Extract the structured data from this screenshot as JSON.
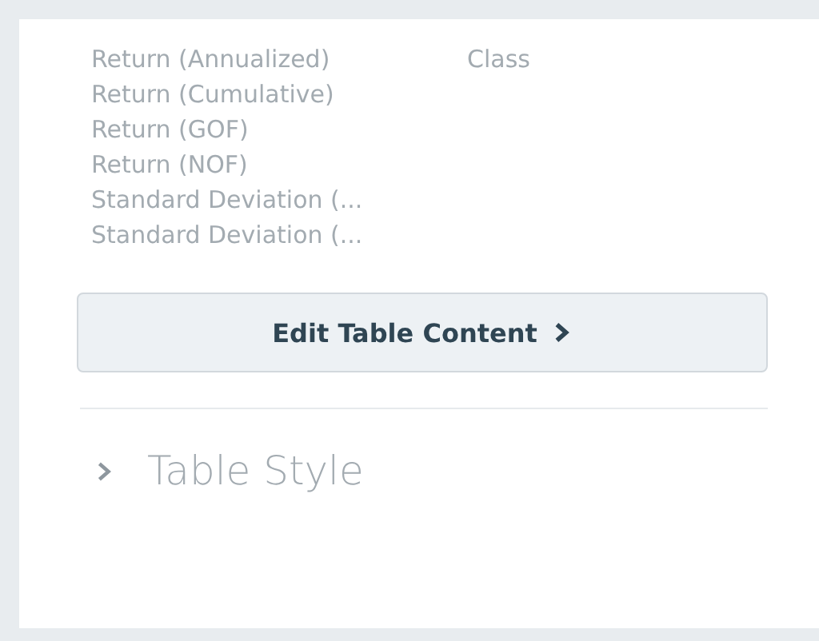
{
  "fields": [
    {
      "label": "Return (Annualized)",
      "column_2": "Class"
    },
    {
      "label": "Return (Cumulative)"
    },
    {
      "label": "Return (GOF)"
    },
    {
      "label": "Return (NOF)"
    },
    {
      "label": "Standard Deviation (..."
    },
    {
      "label": "Standard Deviation (..."
    }
  ],
  "edit_button": {
    "label": "Edit Table Content"
  },
  "sections": [
    {
      "title": "Table Style",
      "expanded": false
    }
  ]
}
